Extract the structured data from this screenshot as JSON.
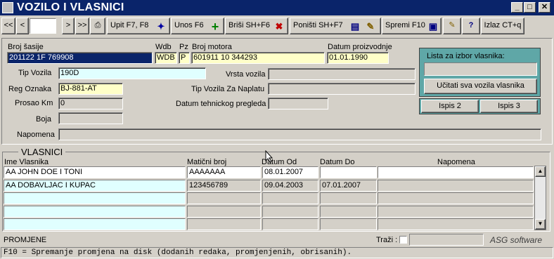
{
  "window": {
    "title": "VOZILO I VLASNICI",
    "controls": [
      "_",
      "□",
      "✕"
    ]
  },
  "toolbar": {
    "nav_first": "<<",
    "nav_prev": "<",
    "nav_next": ">",
    "nav_last": ">>",
    "upit": "Upit F7, F8",
    "unos": "Unos F6",
    "brisi": "Briši  SH+F6",
    "ponisti": "Poništi SH+F7",
    "spremi": "Spremi F10",
    "izlaz": "Izlaz CT+q"
  },
  "vehicle": {
    "broj_sasije_label": "Broj šasije",
    "broj_sasije": "201122 1F 769908",
    "wdb_label": "Wdb",
    "wdb": "WDB",
    "pz_label": "Pz",
    "pz": "P",
    "broj_motora_label": "Broj motora",
    "broj_motora": "601911 10 344293",
    "datum_proizvodnje_label": "Datum proizvodnje",
    "datum_proizvodnje": "01.01.1990",
    "tip_vozila_label": "Tip Vozila",
    "tip_vozila": "190D",
    "vrsta_vozila_label": "Vrsta vozila",
    "vrsta_vozila": "",
    "reg_oznaka_label": "Reg Oznaka",
    "reg_oznaka": "BJ-881-AT",
    "tip_naplata_label": "Tip Vozila Za Naplatu",
    "tip_naplata": "",
    "prosao_km_label": "Prosao Km",
    "prosao_km": "0",
    "datum_pregleda_label": "Datum tehnickog pregleda",
    "datum_pregleda": "",
    "boja_label": "Boja",
    "boja": "",
    "napomena_label": "Napomena",
    "napomena": ""
  },
  "owner_panel": {
    "label": "Lista za izbor vlasnika:",
    "value": "",
    "load_button": "Učitati sva vozila vlasnika",
    "ispis2": "Ispis 2",
    "ispis3": "Ispis 3"
  },
  "owners": {
    "section_title": "VLASNICI",
    "columns": [
      "Ime Vlasnika",
      "Matični broj",
      "Datum Od",
      "Datum Do",
      "Napomena"
    ],
    "rows": [
      [
        "AA JOHN DOE I TONI",
        "AAAAAAA",
        "08.01.2007",
        "",
        ""
      ],
      [
        "AA DOBAVLJAC I KUPAC",
        "123456789",
        "09.04.2003",
        "07.01.2007",
        ""
      ],
      [
        "",
        "",
        "",
        "",
        ""
      ],
      [
        "",
        "",
        "",
        "",
        ""
      ],
      [
        "",
        "",
        "",
        "",
        ""
      ]
    ]
  },
  "status": {
    "mode": "PROMJENE",
    "trazi_label": "Traži :",
    "brand": "ASG software",
    "message": "F10 = Spremanje promjena na disk (dodanih redaka, promjenjenih, obrisanih)."
  }
}
